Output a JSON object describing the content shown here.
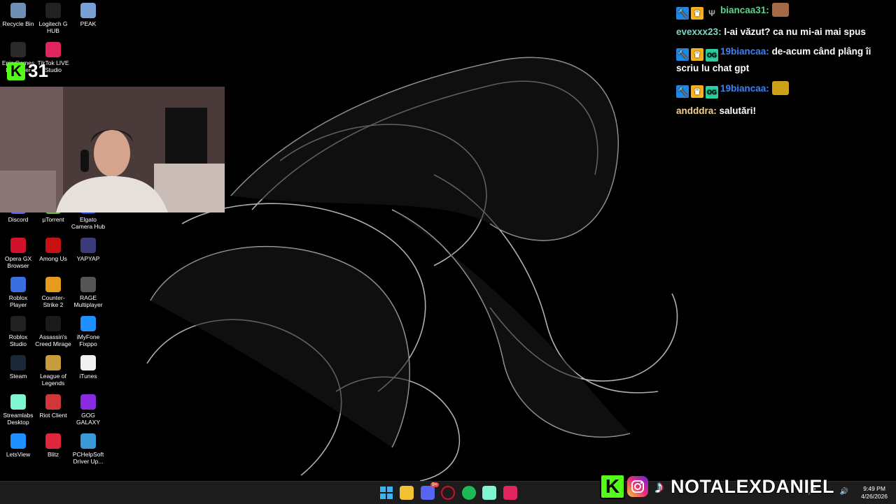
{
  "desktop_icons": [
    {
      "label": "Recycle Bin",
      "icon": "recycle-bin-icon",
      "color": "#6f8fb5"
    },
    {
      "label": "Logitech G HUB",
      "icon": "logitech-g-icon",
      "color": "#222222"
    },
    {
      "label": "PEAK",
      "icon": "peak-icon",
      "color": "#7aa0d8"
    },
    {
      "label": "Epic Games Launcher",
      "icon": "epic-games-icon",
      "color": "#2a2a2a"
    },
    {
      "label": "TikTok LIVE Studio",
      "icon": "tiktok-live-icon",
      "color": "#e0245e"
    },
    {
      "label": "Discord",
      "icon": "discord-icon",
      "color": "#5865f2"
    },
    {
      "label": "µTorrent",
      "icon": "utorrent-icon",
      "color": "#76b83f"
    },
    {
      "label": "Elgato Camera Hub",
      "icon": "elgato-icon",
      "color": "#1a3fd0"
    },
    {
      "label": "Opera GX Browser",
      "icon": "opera-gx-icon",
      "color": "#d0122a"
    },
    {
      "label": "Among Us",
      "icon": "among-us-icon",
      "color": "#c51111"
    },
    {
      "label": "YAPYAP",
      "icon": "yapyap-icon",
      "color": "#3c3c7a"
    },
    {
      "label": "Roblox Player",
      "icon": "roblox-player-icon",
      "color": "#3a6fe0"
    },
    {
      "label": "Counter-Strike 2",
      "icon": "cs2-icon",
      "color": "#e89a1e"
    },
    {
      "label": "RAGE Multiplayer",
      "icon": "rage-mp-icon",
      "color": "#555555"
    },
    {
      "label": "Roblox Studio",
      "icon": "roblox-studio-icon",
      "color": "#222222"
    },
    {
      "label": "Assassin's Creed Mirage",
      "icon": "ac-mirage-icon",
      "color": "#1b1b1b"
    },
    {
      "label": "iMyFone Fixppo",
      "icon": "fixppo-icon",
      "color": "#1e90ff"
    },
    {
      "label": "Steam",
      "icon": "steam-icon",
      "color": "#1b2838"
    },
    {
      "label": "League of Legends",
      "icon": "lol-icon",
      "color": "#c89b3c"
    },
    {
      "label": "iTunes",
      "icon": "itunes-icon",
      "color": "#f0f0f0"
    },
    {
      "label": "Streamlabs Desktop",
      "icon": "streamlabs-icon",
      "color": "#80f5d2"
    },
    {
      "label": "Riot Client",
      "icon": "riot-client-icon",
      "color": "#d13639"
    },
    {
      "label": "GOG GALAXY",
      "icon": "gog-icon",
      "color": "#8a2be2"
    },
    {
      "label": "LetsView",
      "icon": "letsview-icon",
      "color": "#1e90ff"
    },
    {
      "label": "Blitz",
      "icon": "blitz-icon",
      "color": "#e0263b"
    },
    {
      "label": "PCHelpSoft Driver Up...",
      "icon": "driver-updater-icon",
      "color": "#3a9ad9"
    }
  ],
  "kick_counter": "31",
  "chat": [
    {
      "user": "biancaa31:",
      "user_color": "#5fd38d",
      "text": "",
      "badges": [
        "mod",
        "crown",
        "fork"
      ],
      "emote": true
    },
    {
      "user": "evexxx23:",
      "user_color": "#7ad9c7",
      "text": "l-ai văzut? ca nu mi-ai mai spus",
      "badges": []
    },
    {
      "user": "19biancaa:",
      "user_color": "#3b82f6",
      "text": "de-acum când plâng îi scriu lu chat gpt",
      "badges": [
        "mod",
        "crown",
        "og"
      ]
    },
    {
      "user": "19biancaa:",
      "user_color": "#3b82f6",
      "text": "",
      "badges": [
        "mod",
        "crown",
        "og"
      ],
      "emote": true
    },
    {
      "user": "andddra:",
      "user_color": "#f2d28c",
      "text": "salutări!",
      "badges": []
    }
  ],
  "overlay": {
    "handle": "NOTALEXDANIEL",
    "kick_letter": "K"
  },
  "taskbar": {
    "apps": [
      "windows-start-icon",
      "file-explorer-icon",
      "discord-icon",
      "opera-gx-icon",
      "spotify-icon",
      "streamlabs-icon",
      "tiktok-live-icon"
    ],
    "discord_badge": "9+",
    "time": "9:49 PM",
    "date": "4/26/2026"
  }
}
